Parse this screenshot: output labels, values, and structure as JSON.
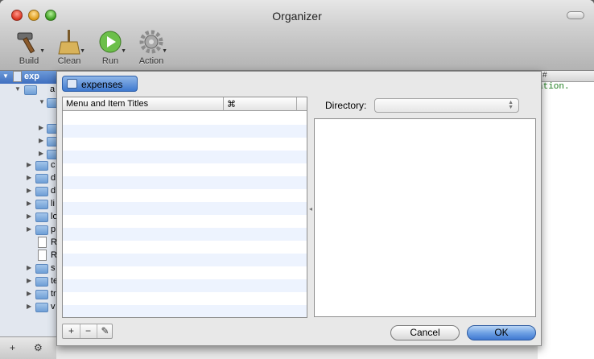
{
  "window": {
    "title": "Organizer"
  },
  "toolbar": {
    "items": [
      {
        "label": "Build",
        "icon": "hammer-icon"
      },
      {
        "label": "Clean",
        "icon": "broom-icon"
      },
      {
        "label": "Run",
        "icon": "play-icon"
      },
      {
        "label": "Action",
        "icon": "gear-icon"
      }
    ]
  },
  "tree": {
    "selected_label": "exp",
    "rows": [
      {
        "label": "a"
      },
      {
        "label": "c"
      },
      {
        "label": "d"
      },
      {
        "label": "d"
      },
      {
        "label": "li"
      },
      {
        "label": "lo"
      },
      {
        "label": "p"
      },
      {
        "label": "R"
      },
      {
        "label": "R"
      },
      {
        "label": "s"
      },
      {
        "label": "te"
      },
      {
        "label": "tr"
      },
      {
        "label": "v"
      }
    ],
    "add_label": "+",
    "gear_label": "⚙"
  },
  "editor": {
    "visible_text": "ation.",
    "bar_text": "#"
  },
  "sheet": {
    "token_label": "expenses",
    "table": {
      "col_title": "Menu and Item Titles",
      "col_shortcut": "⌘",
      "rows": []
    },
    "directory_label": "Directory:",
    "directory_value": "",
    "segment": {
      "add": "+",
      "remove": "−",
      "edit": "✎"
    },
    "cancel_label": "Cancel",
    "ok_label": "OK"
  },
  "colors": {
    "accent": "#3f79cf",
    "stripe": "#edf3fe"
  }
}
